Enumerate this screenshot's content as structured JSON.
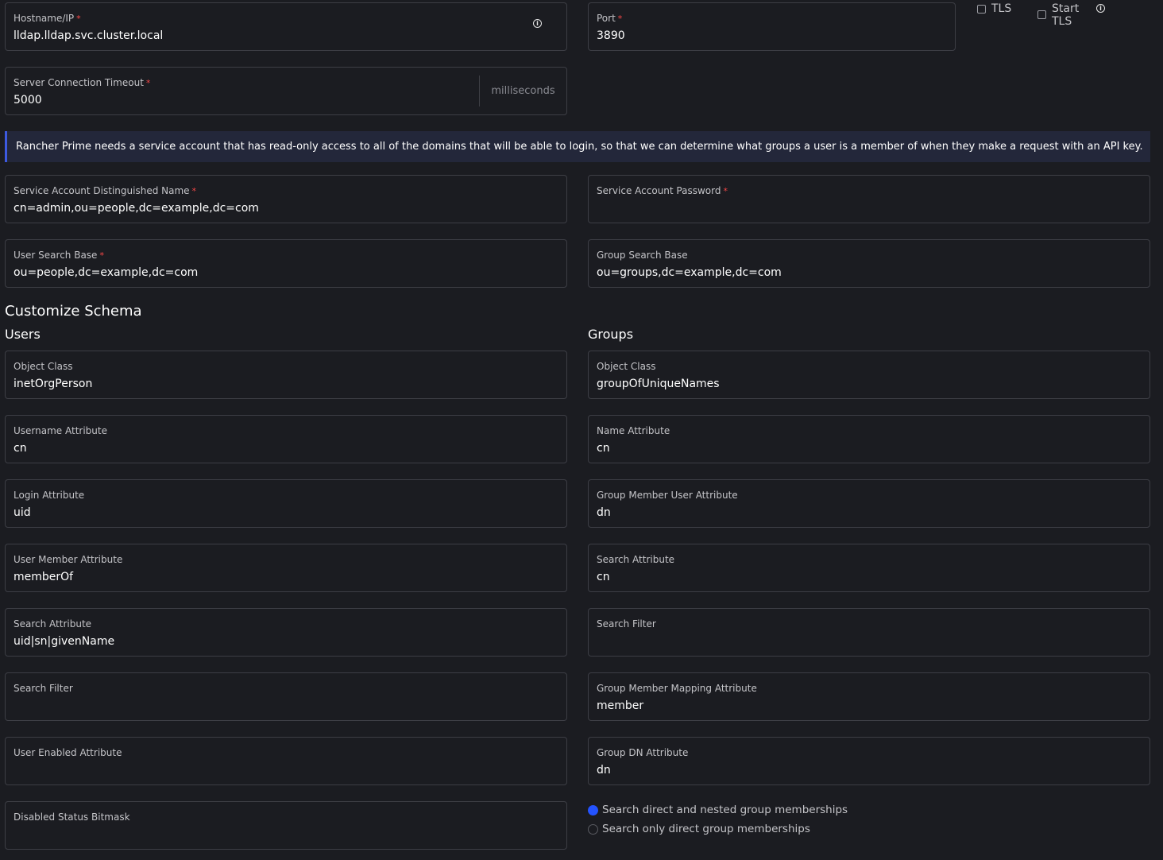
{
  "connection": {
    "hostname": {
      "label": "Hostname/IP",
      "required": "*",
      "value": "lldap.lldap.svc.cluster.local"
    },
    "port": {
      "label": "Port",
      "required": "*",
      "value": "3890"
    },
    "tls": {
      "label": "TLS",
      "checked": false
    },
    "start_tls": {
      "label_line1": "Start",
      "label_line2": "TLS",
      "checked": false
    },
    "timeout": {
      "label": "Server Connection Timeout",
      "required": "*",
      "value": "5000",
      "suffix": "milliseconds"
    }
  },
  "banner": {
    "text": "Rancher Prime needs a service account that has read-only access to all of the domains that will be able to login, so that we can determine what groups a user is a member of when they make a request with an API key."
  },
  "service_account": {
    "dn": {
      "label": "Service Account Distinguished Name",
      "required": "*",
      "value": "cn=admin,ou=people,dc=example,dc=com"
    },
    "password": {
      "label": "Service Account Password",
      "required": "*",
      "value": ""
    }
  },
  "search_base": {
    "user": {
      "label": "User Search Base",
      "required": "*",
      "value": "ou=people,dc=example,dc=com"
    },
    "group": {
      "label": "Group Search Base",
      "value": "ou=groups,dc=example,dc=com"
    }
  },
  "schema": {
    "title": "Customize Schema",
    "users": {
      "title": "Users",
      "object_class": {
        "label": "Object Class",
        "value": "inetOrgPerson"
      },
      "username_attr": {
        "label": "Username Attribute",
        "value": "cn"
      },
      "login_attr": {
        "label": "Login Attribute",
        "value": "uid"
      },
      "member_attr": {
        "label": "User Member Attribute",
        "value": "memberOf"
      },
      "search_attr": {
        "label": "Search Attribute",
        "value": "uid|sn|givenName"
      },
      "search_filter": {
        "label": "Search Filter",
        "value": ""
      },
      "enabled_attr": {
        "label": "User Enabled Attribute",
        "value": ""
      },
      "disabled_bitmask": {
        "label": "Disabled Status Bitmask",
        "value": ""
      }
    },
    "groups": {
      "title": "Groups",
      "object_class": {
        "label": "Object Class",
        "value": "groupOfUniqueNames"
      },
      "name_attr": {
        "label": "Name Attribute",
        "value": "cn"
      },
      "member_user_attr": {
        "label": "Group Member User Attribute",
        "value": "dn"
      },
      "search_attr": {
        "label": "Search Attribute",
        "value": "cn"
      },
      "search_filter": {
        "label": "Search Filter",
        "value": ""
      },
      "member_mapping_attr": {
        "label": "Group Member Mapping Attribute",
        "value": "member"
      },
      "dn_attr": {
        "label": "Group DN Attribute",
        "value": "dn"
      },
      "membership": {
        "options": [
          "Search direct and nested group memberships",
          "Search only direct group memberships"
        ],
        "selected": "Search direct and nested group memberships"
      }
    }
  },
  "colors": {
    "background": "#1b1c21",
    "border": "#3d3e45",
    "accent": "#2453ff",
    "required": "#f64747"
  }
}
